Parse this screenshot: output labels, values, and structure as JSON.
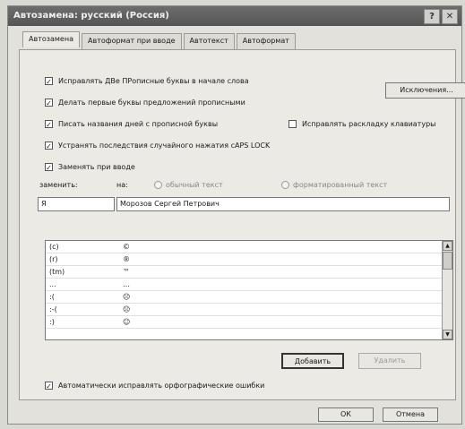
{
  "window": {
    "title": "Автозамена: русский (Россия)",
    "help_glyph": "?",
    "close_glyph": "✕"
  },
  "tabs": [
    {
      "label": "Автозамена",
      "active": true
    },
    {
      "label": "Автоформат при вводе",
      "active": false
    },
    {
      "label": "Автотекст",
      "active": false
    },
    {
      "label": "Автоформат",
      "active": false
    }
  ],
  "options": {
    "two_caps": {
      "label": "Исправлять ДВе ПРописные буквы в начале слова",
      "checked": true
    },
    "first_cap": {
      "label": "Делать первые буквы предложений прописными",
      "checked": true
    },
    "day_names": {
      "label": "Писать названия дней с прописной буквы",
      "checked": true
    },
    "keyboard_layout": {
      "label": "Исправлять раскладку клавиатуры",
      "checked": false
    },
    "caps_lock": {
      "label": "Устранять последствия случайного нажатия cAPS LOCK",
      "checked": true
    },
    "replace_as_type": {
      "label": "Заменять при вводе",
      "checked": true
    },
    "auto_spell": {
      "label": "Автоматически исправлять орфографические ошибки",
      "checked": true
    }
  },
  "exceptions_button": "Исключения...",
  "replace": {
    "replace_label": "заменить:",
    "with_label": "на:",
    "plain_text_label": "обычный текст",
    "formatted_text_label": "форматированный текст",
    "replace_value": "Я",
    "with_value": "Морозов Сергей Петрович"
  },
  "entries": [
    {
      "key": "(c)",
      "value": "©"
    },
    {
      "key": "(r)",
      "value": "®"
    },
    {
      "key": "(tm)",
      "value": "™"
    },
    {
      "key": "...",
      "value": "…"
    },
    {
      "key": ":(",
      "value": "☹"
    },
    {
      "key": ":-(",
      "value": "☹"
    },
    {
      "key": ":)",
      "value": "☺"
    }
  ],
  "buttons": {
    "add": "Добавить",
    "delete": "Удалить",
    "ok": "ОК",
    "cancel": "Отмена"
  }
}
